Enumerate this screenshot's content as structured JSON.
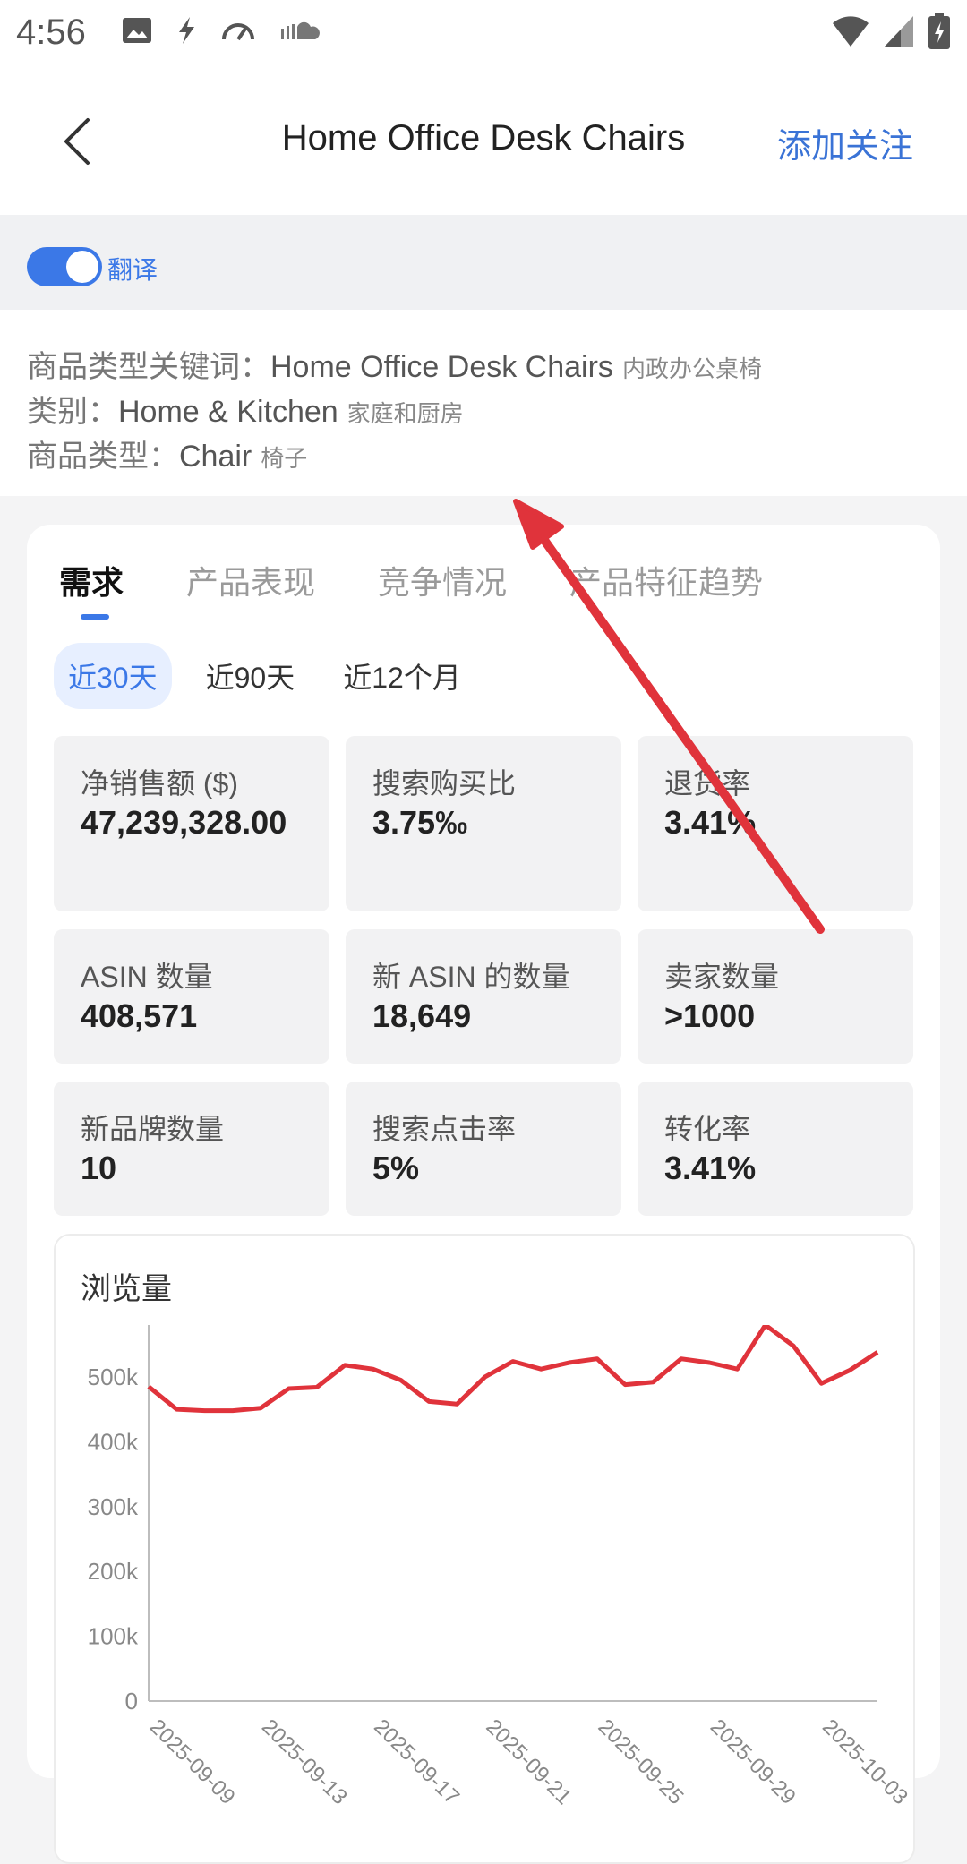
{
  "status_bar": {
    "time": "4:56",
    "left_icons": [
      "image-icon",
      "flash-icon",
      "speedometer-icon",
      "cloud-icon"
    ],
    "right_icons": [
      "wifi-icon",
      "cell-signal-icon",
      "battery-icon"
    ]
  },
  "header": {
    "title": "Home Office Desk Chairs",
    "follow_label": "添加关注"
  },
  "translate": {
    "label": "翻译",
    "enabled": true
  },
  "info": {
    "keyword": {
      "label": "商品类型关键词：",
      "value": "Home Office Desk Chairs",
      "cn": "内政办公桌椅"
    },
    "category": {
      "label": "类别：",
      "value": "Home & Kitchen",
      "cn": "家庭和厨房"
    },
    "type": {
      "label": "商品类型：",
      "value": "Chair",
      "cn": "椅子"
    }
  },
  "tabs": [
    "需求",
    "产品表现",
    "竞争情况",
    "产品特征趋势"
  ],
  "active_tab": "需求",
  "periods": [
    "近30天",
    "近90天",
    "近12个月"
  ],
  "active_period": "近30天",
  "metrics": [
    {
      "label": "净销售额 ($)",
      "value": "47,239,328.00"
    },
    {
      "label": "搜索购买比",
      "value": "3.75‰"
    },
    {
      "label": "退货率",
      "value": "3.41%"
    },
    {
      "label": "ASIN 数量",
      "value": "408,571"
    },
    {
      "label": "新 ASIN 的数量",
      "value": "18,649"
    },
    {
      "label": "卖家数量",
      "value": ">1000"
    },
    {
      "label": "新品牌数量",
      "value": "10"
    },
    {
      "label": "搜索点击率",
      "value": "5%"
    },
    {
      "label": "转化率",
      "value": "3.41%"
    }
  ],
  "colors": {
    "accent": "#3b78e7",
    "series": "#e0333b",
    "annotation": "#e0333b"
  },
  "chart_data": {
    "type": "line",
    "title": "浏览量",
    "x": [
      "2025-09-09",
      "2025-09-10",
      "2025-09-11",
      "2025-09-12",
      "2025-09-13",
      "2025-09-14",
      "2025-09-15",
      "2025-09-16",
      "2025-09-17",
      "2025-09-18",
      "2025-09-19",
      "2025-09-20",
      "2025-09-21",
      "2025-09-22",
      "2025-09-23",
      "2025-09-24",
      "2025-09-25",
      "2025-09-26",
      "2025-09-27",
      "2025-09-28",
      "2025-09-29",
      "2025-09-30",
      "2025-10-01",
      "2025-10-02",
      "2025-10-03",
      "2025-10-04",
      "2025-10-05"
    ],
    "x_tick_labels": [
      "2025-09-09",
      "2025-09-13",
      "2025-09-17",
      "2025-09-21",
      "2025-09-25",
      "2025-09-29",
      "2025-10-03"
    ],
    "series": [
      {
        "values": [
          485000,
          450000,
          448000,
          448000,
          452000,
          482000,
          484000,
          518000,
          512000,
          495000,
          462000,
          458000,
          500000,
          524000,
          512000,
          522000,
          528000,
          488000,
          492000,
          528000,
          522000,
          512000,
          580000,
          548000,
          490000,
          510000,
          538000
        ]
      }
    ],
    "y_ticks": [
      "0",
      "100k",
      "200k",
      "300k",
      "400k",
      "500k"
    ],
    "ylim": [
      0,
      580000
    ],
    "grid": false,
    "legend": "none"
  }
}
